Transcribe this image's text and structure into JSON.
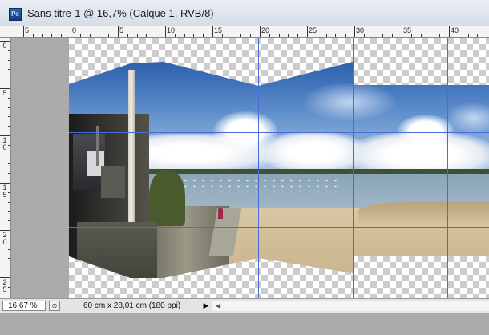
{
  "window": {
    "app_icon": "Ps",
    "title": "Sans titre-1 @ 16,7% (Calque 1, RVB/8)"
  },
  "ruler_horizontal": [
    "5",
    "0",
    "5",
    "10",
    "15",
    "20",
    "25",
    "30",
    "35",
    "40"
  ],
  "ruler_vertical": [
    "0",
    "5",
    "1\n0",
    "1\n5",
    "2\n0",
    "2\n5"
  ],
  "status": {
    "zoom": "16,67 %",
    "doc_info": "60 cm x 28,01 cm (180 ppi)",
    "menu_arrow": "▶",
    "scroll_left": "◀"
  },
  "colors": {
    "guide_blue": "#4a6bd8",
    "guide_cyan": "#5fd0e0",
    "sky": "#3c6fb8",
    "sand": "#cdbb94",
    "water": "#9fb6c4"
  }
}
